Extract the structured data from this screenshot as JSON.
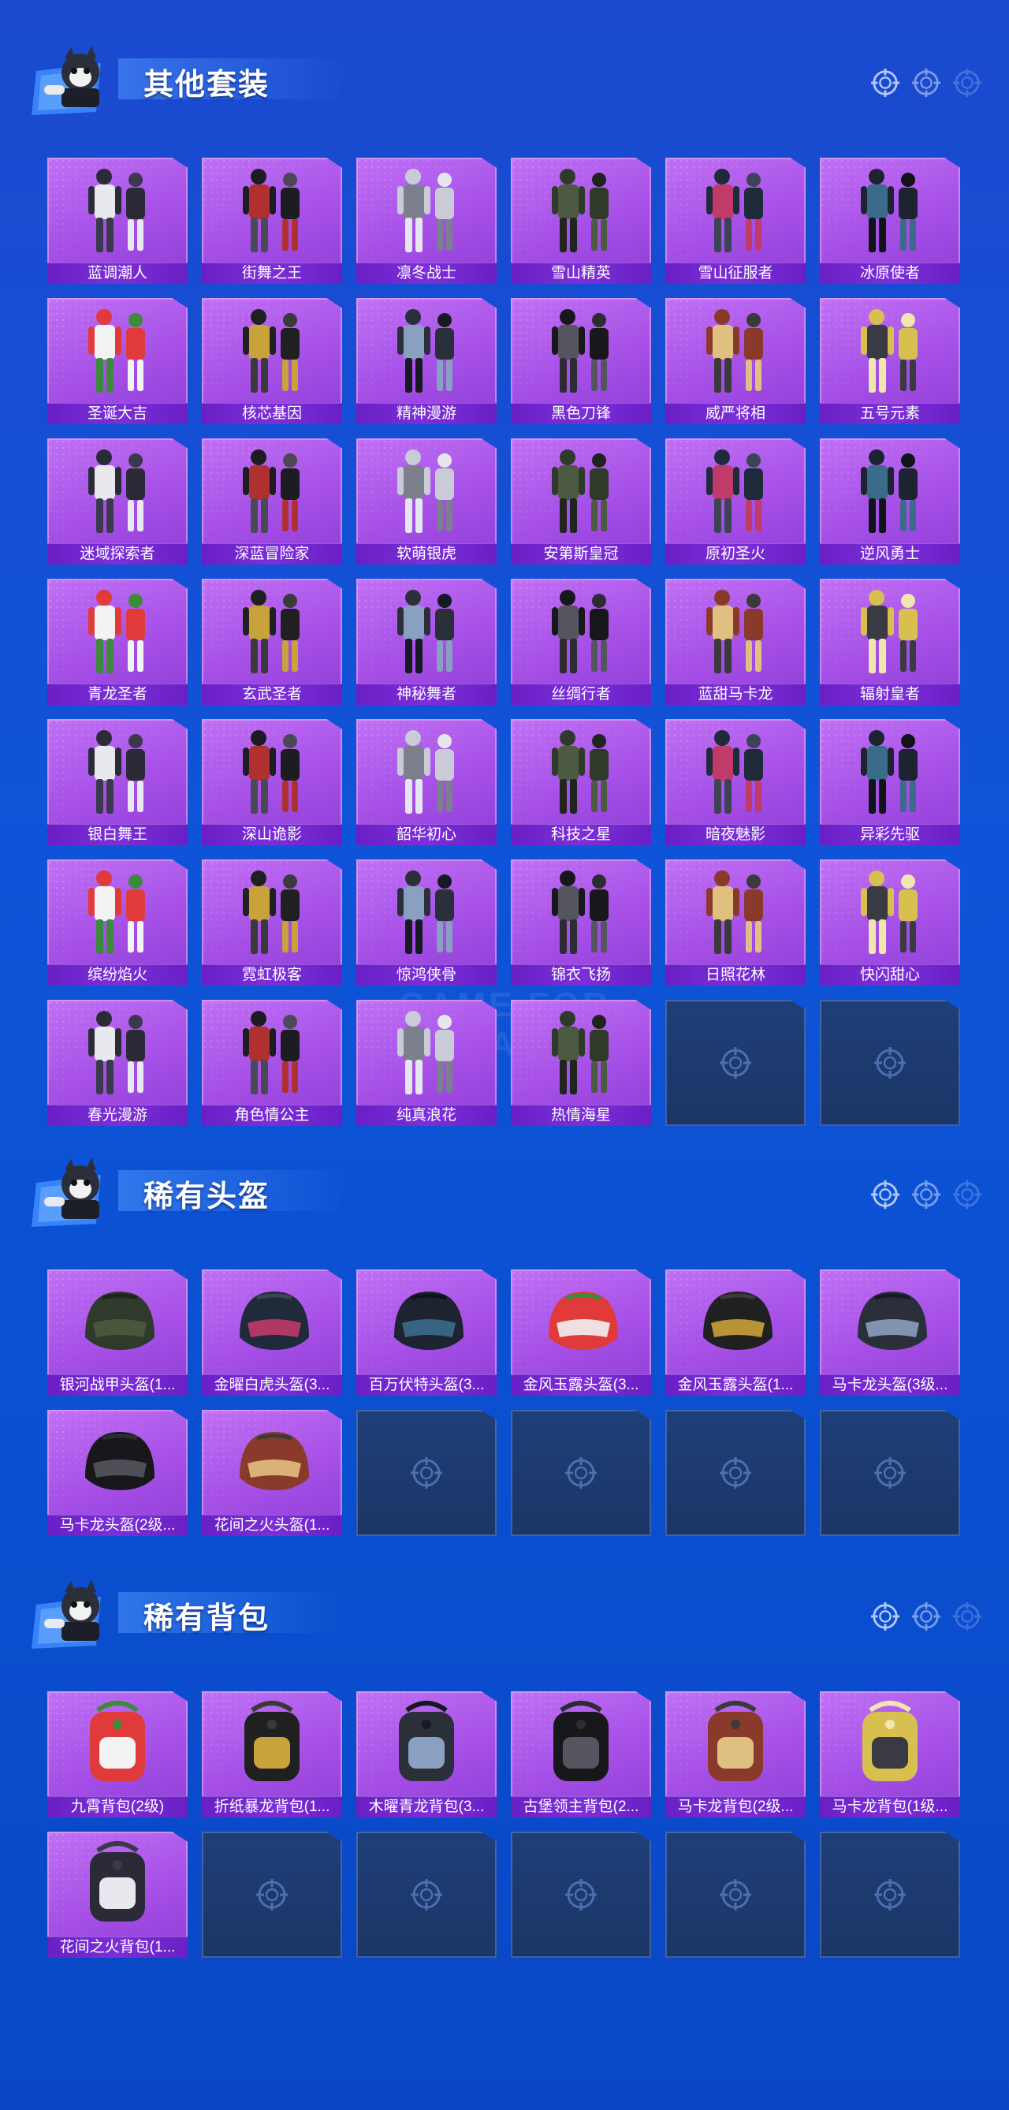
{
  "watermark": "GAME FOR PEACE",
  "colors": {
    "card_purple": "#a54fe6",
    "label_purple": "#7c2fd8",
    "empty_slot": "#1f3f78",
    "background_blue": "#0f54d8"
  },
  "sections": [
    {
      "title": "其他套装",
      "kind": "outfit",
      "items": [
        "蓝调潮人",
        "街舞之王",
        "凛冬战士",
        "雪山精英",
        "雪山征服者",
        "冰原使者",
        "圣诞大吉",
        "核芯基因",
        "精神漫游",
        "黑色刀锋",
        "威严将相",
        "五号元素",
        "迷域探索者",
        "深蓝冒险家",
        "软萌银虎",
        "安第斯皇冠",
        "原初圣火",
        "逆风勇士",
        "青龙圣者",
        "玄武圣者",
        "神秘舞者",
        "丝绸行者",
        "蓝甜马卡龙",
        "辐射皇者",
        "银白舞王",
        "深山诡影",
        "韶华初心",
        "科技之星",
        "暗夜魅影",
        "异彩先驱",
        "缤纷焰火",
        "霓虹极客",
        "惊鸿侠骨",
        "锦衣飞扬",
        "日照花林",
        "快闪甜心",
        "春光漫游",
        "角色情公主",
        "纯真浪花",
        "热情海星"
      ],
      "empty_slots": 2
    },
    {
      "title": "稀有头盔",
      "kind": "helmet",
      "items": [
        "银河战甲头盔(1...",
        "金曜白虎头盔(3...",
        "百万伏特头盔(3...",
        "金风玉露头盔(3...",
        "金风玉露头盔(1...",
        "马卡龙头盔(3级...",
        "马卡龙头盔(2级...",
        "花间之火头盔(1..."
      ],
      "empty_slots": 4
    },
    {
      "title": "稀有背包",
      "kind": "backpack",
      "items": [
        "九霄背包(2级)",
        "折纸暴龙背包(1...",
        "木曜青龙背包(3...",
        "古堡领主背包(2...",
        "马卡龙背包(2级...",
        "马卡龙背包(1级...",
        "花间之火背包(1..."
      ],
      "empty_slots": 5
    }
  ]
}
